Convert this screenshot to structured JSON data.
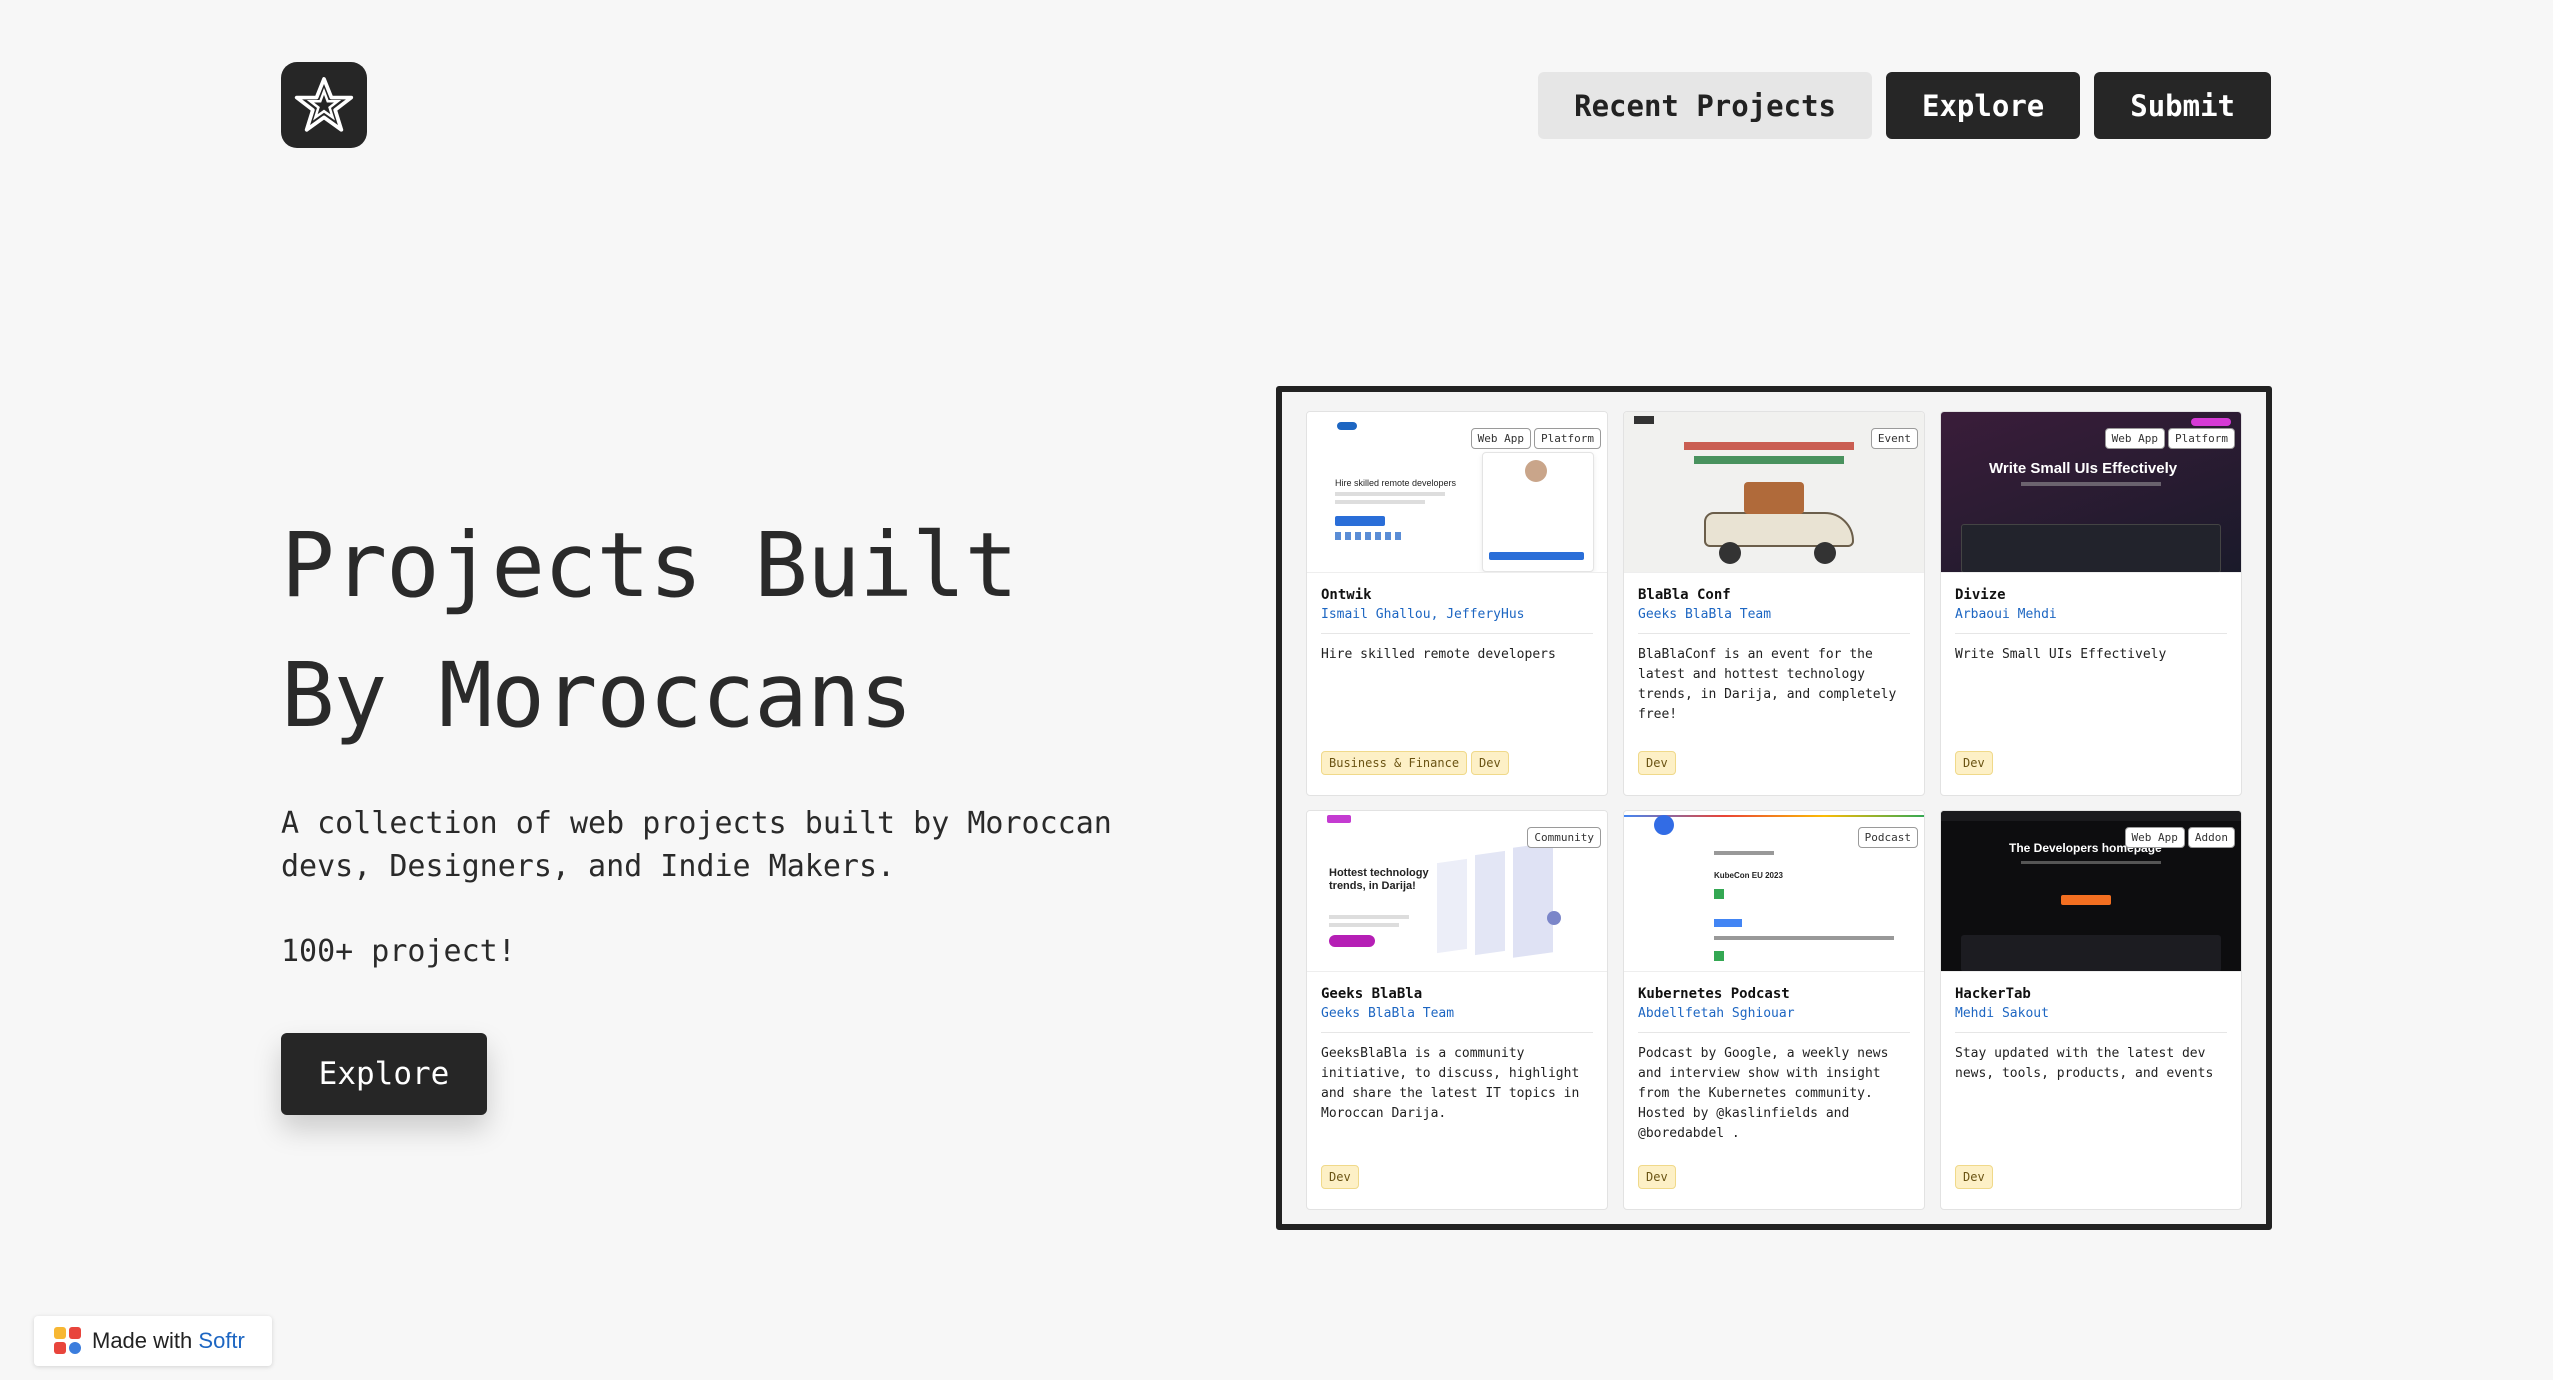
{
  "header": {
    "logo_icon": "star-logo-icon",
    "nav": [
      {
        "label": "Recent Projects",
        "style": "light"
      },
      {
        "label": "Explore",
        "style": "dark"
      },
      {
        "label": "Submit",
        "style": "dark"
      }
    ]
  },
  "hero": {
    "title_line1": "Projects Built",
    "title_line2": "By Moroccans",
    "subtitle": "A collection of web projects built by Moroccan devs, Designers, and Indie Makers.",
    "count": "100+ project!",
    "cta": "Explore"
  },
  "projects": [
    {
      "name": "Ontwik",
      "authors": "Ismail Ghallou, JefferyHus",
      "description": "Hire skilled remote developers",
      "tags": [
        "Web App",
        "Platform"
      ],
      "categories": [
        "Business & Finance",
        "Dev"
      ],
      "thumb_text": "Hire skilled remote developers"
    },
    {
      "name": "BlaBla Conf",
      "authors": "Geeks BlaBla Team",
      "description": "BlaBlaConf is an event for the latest and hottest technology trends, in Darija, and completely free!",
      "tags": [
        "Event"
      ],
      "categories": [
        "Dev"
      ],
      "thumb_text": ""
    },
    {
      "name": "Divize",
      "authors": "Arbaoui Mehdi",
      "description": "Write Small UIs Effectively",
      "tags": [
        "Web App",
        "Platform"
      ],
      "categories": [
        "Dev"
      ],
      "thumb_text": "Write Small UIs Effectively"
    },
    {
      "name": "Geeks BlaBla",
      "authors": "Geeks BlaBla Team",
      "description": "GeeksBlaBla is a community initiative, to discuss, highlight and share the latest IT topics in Moroccan Darija.",
      "tags": [
        "Community"
      ],
      "categories": [
        "Dev"
      ],
      "thumb_text": "Hottest technology trends, in Darija!"
    },
    {
      "name": "Kubernetes Podcast",
      "authors": "Abdellfetah Sghiouar",
      "description": "Podcast by Google, a weekly news and interview show with insight from the Kubernetes community. Hosted by @kaslinfields and @boredabdel .",
      "tags": [
        "Podcast"
      ],
      "categories": [
        "Dev"
      ],
      "thumb_text": "KubeCon EU 2023"
    },
    {
      "name": "HackerTab",
      "authors": "Mehdi Sakout",
      "description": "Stay updated with the latest dev news, tools, products, and events",
      "tags": [
        "Web App",
        "Addon"
      ],
      "categories": [
        "Dev"
      ],
      "thumb_text": "The Developers homepage"
    }
  ],
  "badge": {
    "made_with": "Made with",
    "brand": "Softr"
  }
}
